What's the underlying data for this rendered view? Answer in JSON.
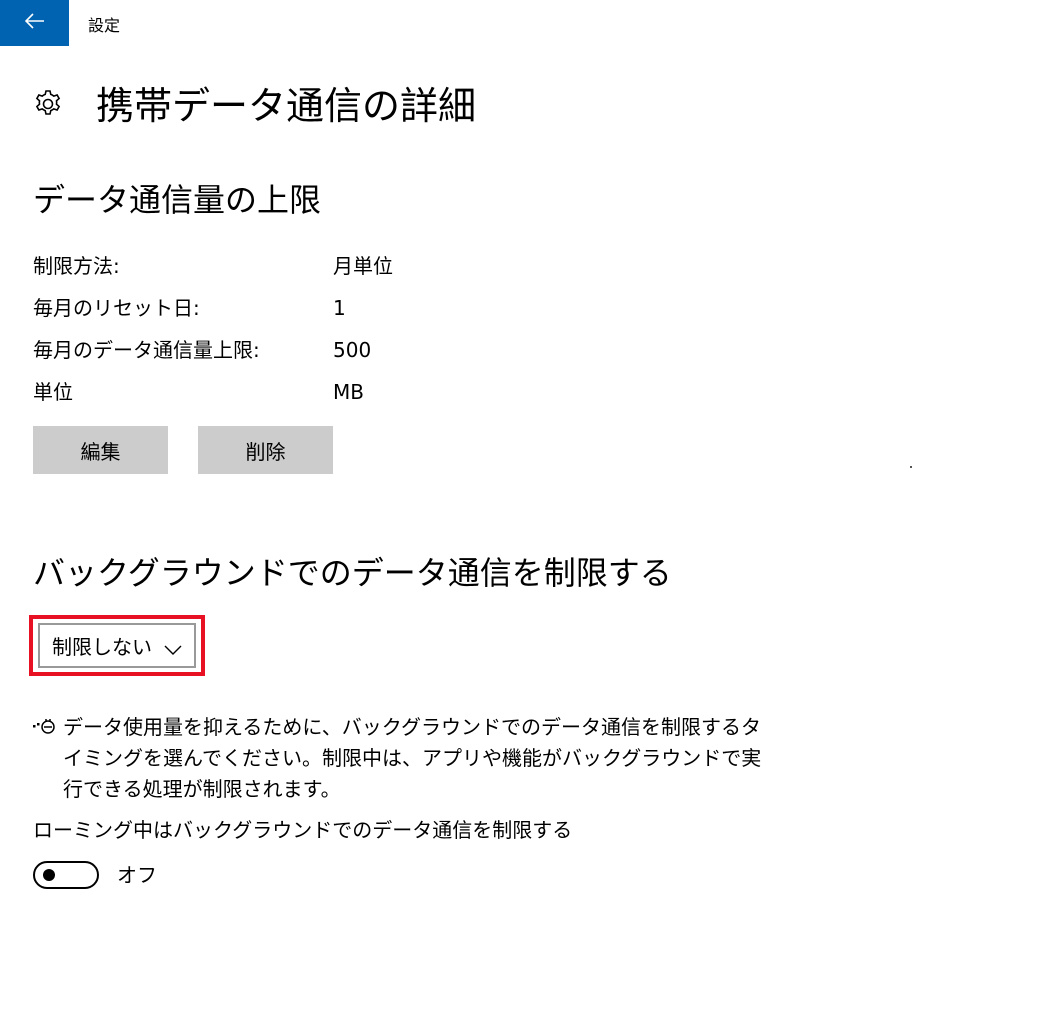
{
  "titlebar": {
    "app_title": "設定",
    "back_icon": "back-arrow-icon",
    "accent_color": "#0063b1"
  },
  "header": {
    "icon": "gear-icon",
    "title": "携帯データ通信の詳細"
  },
  "data_limit": {
    "section_title": "データ通信量の上限",
    "rows": [
      {
        "label": "制限方法:",
        "value": "月単位"
      },
      {
        "label": "毎月のリセット日:",
        "value": "1"
      },
      {
        "label": "毎月のデータ通信量上限:",
        "value": "500"
      },
      {
        "label": "単位",
        "value": "MB"
      }
    ],
    "edit_label": "編集",
    "delete_label": "削除"
  },
  "background": {
    "section_title": "バックグラウンドでのデータ通信を制限する",
    "dropdown_value": "制限しない",
    "highlight_color": "#e81123",
    "info_icon": "battery-saver-icon",
    "info_lines": [
      "データ使用量を抑えるために、バックグラウンドでのデータ通信を制限するタ",
      "イミングを選んでください。制限中は、アプリや機能がバックグラウンドで実",
      "行できる処理が制限されます。"
    ],
    "roaming_label": "ローミング中はバックグラウンドでのデータ通信を制限する",
    "toggle_state": "オフ"
  }
}
